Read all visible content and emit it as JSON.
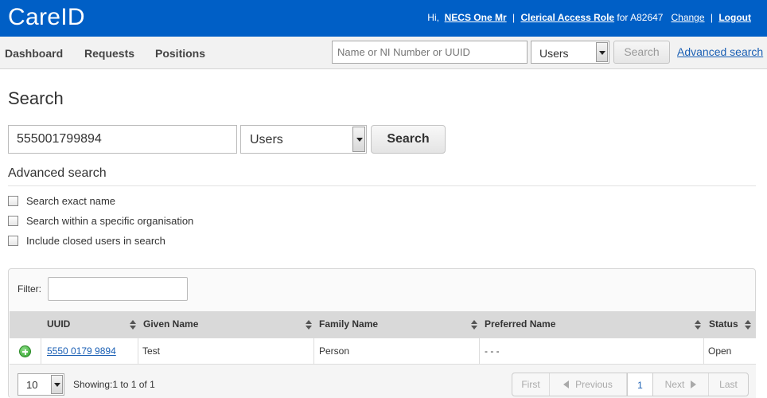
{
  "header": {
    "logo": "CareID",
    "greeting": "Hi,",
    "user_name": "NECS One Mr",
    "role_link": "Clerical Access Role",
    "role_suffix": " for A82647",
    "change_link": "Change",
    "logout_link": "Logout",
    "separator": "|"
  },
  "nav": {
    "items": [
      "Dashboard",
      "Requests",
      "Positions"
    ],
    "search_placeholder": "Name or NI Number or UUID",
    "search_type": "Users",
    "search_button": "Search",
    "advanced_link": "Advanced search"
  },
  "search": {
    "title": "Search",
    "query_value": "555001799894",
    "type_value": "Users",
    "search_button": "Search",
    "advanced_title": "Advanced search",
    "options": [
      "Search exact name",
      "Search within a specific organisation",
      "Include closed users in search"
    ]
  },
  "table": {
    "filter_label": "Filter:",
    "columns": [
      "UUID",
      "Given Name",
      "Family Name",
      "Preferred Name",
      "Status"
    ],
    "rows": [
      {
        "uuid": "5550 0179 9894",
        "given_name": "Test",
        "family_name": "Person",
        "preferred_name": "- - -",
        "status": "Open"
      }
    ],
    "page_size": "10",
    "showing": "Showing:1 to 1 of 1",
    "pager": {
      "first": "First",
      "previous": "Previous",
      "current": "1",
      "next": "Next",
      "last": "Last"
    }
  },
  "colors": {
    "header_bg": "#005fc6",
    "link": "#1a5fb4",
    "table_header_bg": "#d9d9d9"
  }
}
